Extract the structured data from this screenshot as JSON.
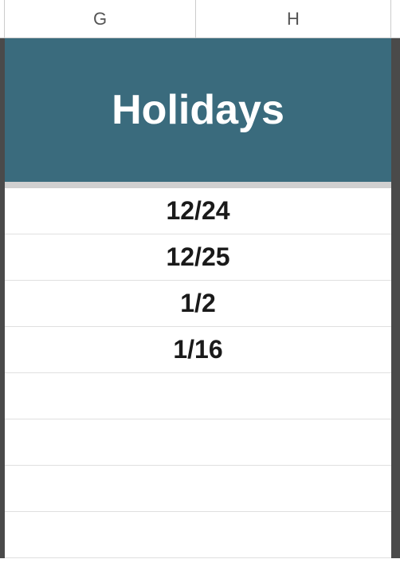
{
  "columns": {
    "g": "G",
    "h": "H"
  },
  "header": {
    "title": "Holidays"
  },
  "rows": [
    "12/24",
    "12/25",
    "1/2",
    "1/16"
  ]
}
